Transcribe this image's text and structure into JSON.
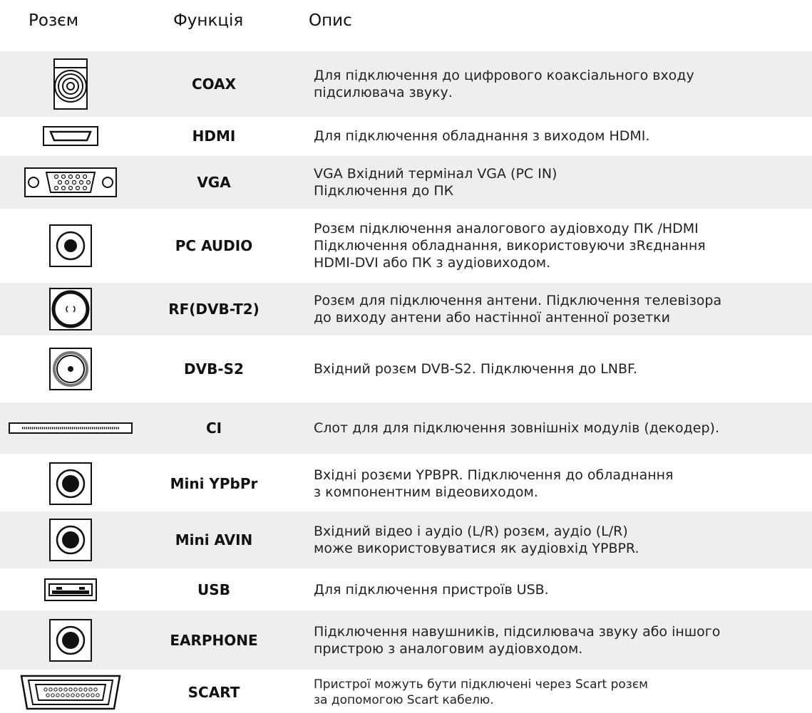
{
  "headers": {
    "connector": "Розєм",
    "function": "Функція",
    "description": "Опис"
  },
  "rows": [
    {
      "icon": "coax-connector-icon",
      "function": "COAX",
      "lines": [
        "Для підключення до цифрового коаксіального входу",
        "підсилювача звуку."
      ]
    },
    {
      "icon": "hdmi-port-icon",
      "function": "HDMI",
      "lines": [
        "Для підключення обладнання з виходом HDMI."
      ]
    },
    {
      "icon": "vga-port-icon",
      "function": "VGA",
      "lines": [
        "VGA Вхідний термінал VGA (PC IN)",
        "Підключення до ПК"
      ]
    },
    {
      "icon": "audio-jack-icon",
      "function": "PC AUDIO",
      "lines": [
        "Розєм підключення аналогового аудіовходу ПК /HDMI",
        "Підключення обладнання, використовуючи зRєднання",
        "HDMI-DVI або ПК з аудіовиходом."
      ]
    },
    {
      "icon": "rf-antenna-icon",
      "function": "RF(DVB-T2)",
      "lines": [
        "Розєм  для підключення антени.  Підключення телевізора",
        "до виходу антени або настінної антенної розетки"
      ]
    },
    {
      "icon": "satellite-input-icon",
      "function": "DVB-S2",
      "lines": [
        "Вхідний  розєм  DVB-S2. Підключення до LNBF."
      ]
    },
    {
      "icon": "ci-slot-icon",
      "function": "CI",
      "lines": [
        "Слот для для підключення зовнішніх модулів (декодер)."
      ]
    },
    {
      "icon": "mini-ypbpr-jack-icon",
      "function": "Mini YPbPr",
      "lines": [
        "Вхідні  розєми  YPBPR.  Підключення до обладнання",
        "з компонентним відеовиходом."
      ]
    },
    {
      "icon": "mini-avin-jack-icon",
      "function": "Mini AVIN",
      "lines": [
        "Вхідний відео і аудіо (L/R)  розєм, аудіо (L/R)",
        "може використовуватися як аудіовхід YPBPR."
      ]
    },
    {
      "icon": "usb-port-icon",
      "function": "USB",
      "lines": [
        "Для підключення пристроїв USB."
      ]
    },
    {
      "icon": "earphone-jack-icon",
      "function": "EARPHONE",
      "lines": [
        "Підключення навушників, підсилювача звуку або іншого",
        "пристрою з аналоговим аудіовходом."
      ]
    },
    {
      "icon": "scart-connector-icon",
      "function": "SCART",
      "lines": [
        "Пристрої можуть бути підключені через Scart розєм",
        "за допомогою Scart кабелю."
      ]
    }
  ]
}
